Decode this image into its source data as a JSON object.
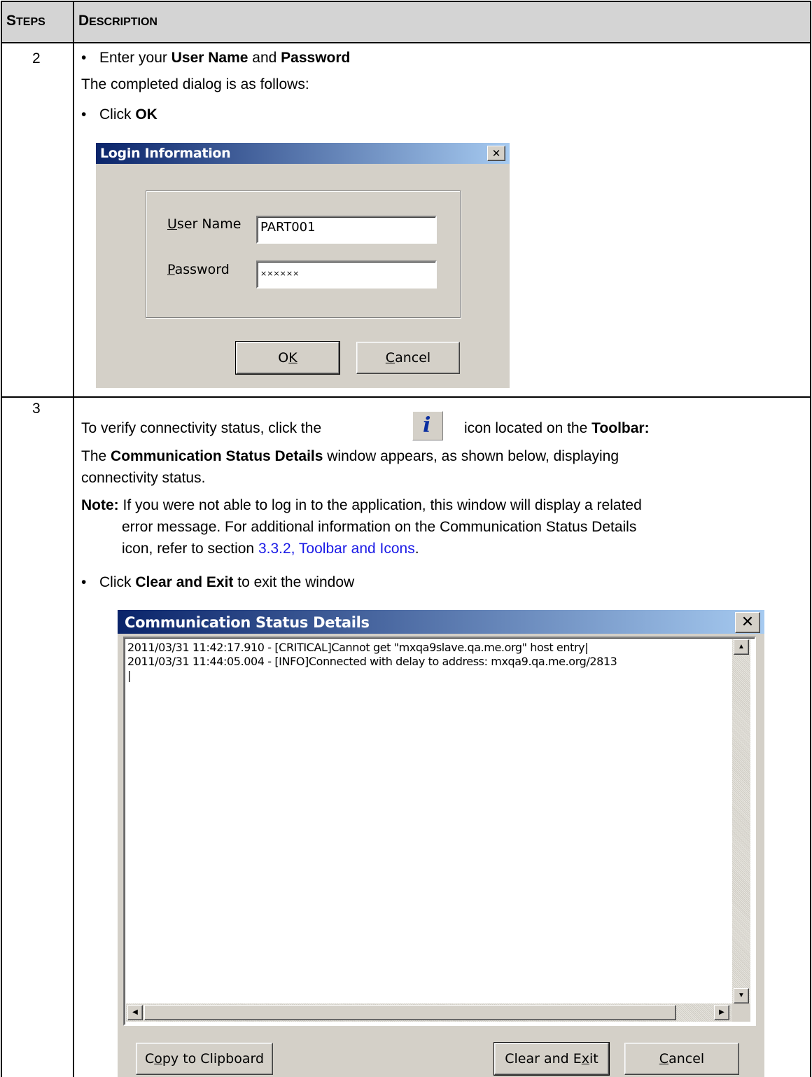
{
  "header": {
    "steps_first": "S",
    "steps_rest": "TEPS",
    "desc_first": "D",
    "desc_rest": "ESCRIPTION"
  },
  "step2": {
    "number": "2",
    "line1_pre": "Enter your ",
    "line1_b1": "User Name",
    "line1_mid": " and ",
    "line1_b2": "Password",
    "line2": "The completed dialog is as follows:",
    "line3_pre": "Click ",
    "line3_b": "OK",
    "bullet": "•"
  },
  "login_dialog": {
    "title": "Login Information",
    "close_glyph": "✕",
    "username_label_u": "U",
    "username_label_rest": "ser Name",
    "username_value": "PART001",
    "password_label_u": "P",
    "password_label_rest": "assword",
    "password_value": "××××××",
    "ok_pre": "O",
    "ok_u": "K",
    "cancel_u": "C",
    "cancel_rest": "ancel"
  },
  "step3": {
    "number": "3",
    "line1_pre": "To verify connectivity status, click the",
    "line1_post": "icon located on the ",
    "line1_b": "Toolbar:",
    "info_glyph": "i",
    "line2_pre": "The ",
    "line2_b": "Communication Status Details",
    "line2_post": " window appears, as shown below, displaying",
    "line3": "connectivity status.",
    "note_label": "Note:",
    "note1": " If you were not able to log in to the application, this window will display a related",
    "note2": "error message. For additional information on the Communication Status Details",
    "note3_pre": "icon, refer to section ",
    "note3_link": "3.3.2,  Toolbar and Icons",
    "note3_post": ".",
    "bullet_pre": "Click ",
    "bullet_b": "Clear and Exit",
    "bullet_post": " to exit the window",
    "bullet": "•"
  },
  "comm_dialog": {
    "title": "Communication Status Details",
    "close_glyph": "✕",
    "log_lines": [
      "2011/03/31 11:42:17.910 - [CRITICAL]Cannot get \"mxqa9slave.qa.me.org\" host entry|",
      "2011/03/31 11:44:05.004 - [INFO]Connected with delay to address: mxqa9.qa.me.org/2813",
      "|"
    ],
    "copy_pre": "C",
    "copy_u": "o",
    "copy_rest": "py to Clipboard",
    "clear_pre": "Clear and E",
    "clear_u": "x",
    "clear_rest": "it",
    "cancel_u": "C",
    "cancel_rest": "ancel",
    "up_arrow": "▲",
    "down_arrow": "▼",
    "left_arrow": "◀",
    "right_arrow": "▶"
  }
}
